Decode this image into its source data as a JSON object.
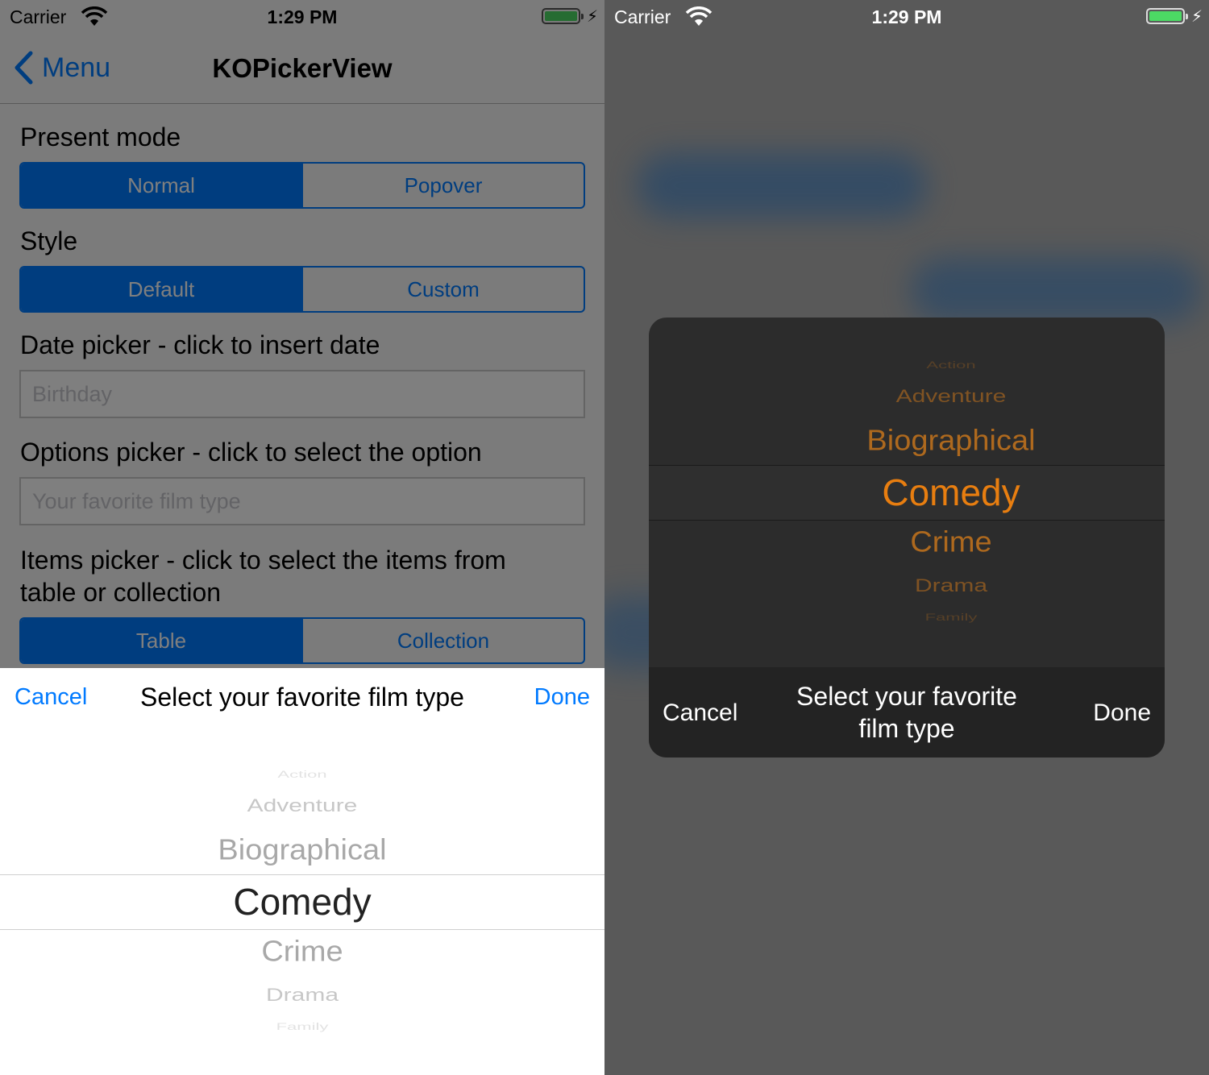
{
  "status_bar": {
    "carrier": "Carrier",
    "time": "1:29 PM"
  },
  "nav": {
    "back_label": "Menu",
    "title": "KOPickerView"
  },
  "form": {
    "present_mode_label": "Present mode",
    "present_mode_options": [
      "Normal",
      "Popover"
    ],
    "style_label": "Style",
    "style_options": [
      "Default",
      "Custom"
    ],
    "date_label": "Date picker - click to insert date",
    "date_placeholder": "Birthday",
    "options_label": "Options picker - click to select the option",
    "options_placeholder": "Your favorite film type",
    "items_label_line1": "Items picker - click to select the items from",
    "items_label_line2": "table or collection",
    "items_options": [
      "Table",
      "Collection"
    ]
  },
  "picker_sheet": {
    "cancel": "Cancel",
    "title": "Select your favorite film type",
    "done": "Done"
  },
  "popup_picker": {
    "cancel": "Cancel",
    "title_line1": "Select your favorite",
    "title_line2": "film type",
    "done": "Done"
  },
  "film_types": [
    "Action",
    "Adventure",
    "Biographical",
    "Comedy",
    "Crime",
    "Drama",
    "Family"
  ],
  "selected_film_type": "Comedy",
  "colors": {
    "accent": "#007aff",
    "popup_accent": "#e87e10",
    "popup_bg": "#2c2c2c"
  }
}
